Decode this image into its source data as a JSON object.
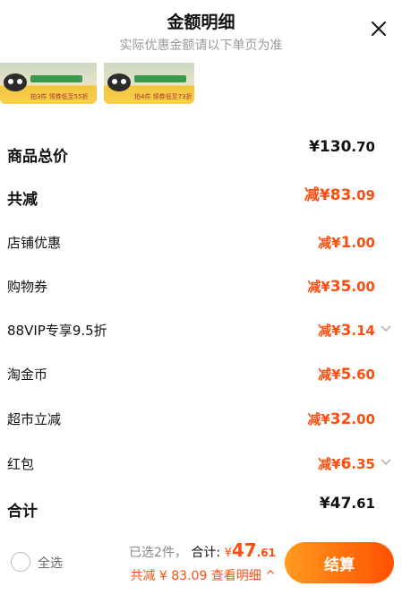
{
  "header": {
    "title": "金额明细",
    "subtitle": "实际优惠金额请以下单页为准"
  },
  "thumbnails": [
    {
      "promo": "拍3件 领券低至55折",
      "badge": "领券满199减30"
    },
    {
      "promo": "拍4件 领券低至73折",
      "badge": "领券满199减30"
    }
  ],
  "rows": [
    {
      "label": "商品总价",
      "prefix": "¥",
      "int": "130",
      "dec": ".70"
    },
    {
      "label": "共减",
      "prefix": "减¥",
      "int": "83",
      "dec": ".09"
    },
    {
      "label": "店铺优惠",
      "prefix": "减¥",
      "int": "1",
      "dec": ".00"
    },
    {
      "label": "购物券",
      "prefix": "减¥",
      "int": "35",
      "dec": ".00"
    },
    {
      "label": "88VIP专享9.5折",
      "prefix": "减¥",
      "int": "3",
      "dec": ".14"
    },
    {
      "label": "淘金币",
      "prefix": "减¥",
      "int": "5",
      "dec": ".60"
    },
    {
      "label": "超市立减",
      "prefix": "减¥",
      "int": "32",
      "dec": ".00"
    },
    {
      "label": "红包",
      "prefix": "减¥",
      "int": "6",
      "dec": ".35"
    },
    {
      "label": "合计",
      "prefix": "¥",
      "int": "47",
      "dec": ".61"
    }
  ],
  "footer": {
    "select_all": "全选",
    "selected": "已选2件，",
    "total_label": "合计:",
    "total_currency": "¥",
    "total_int": "47",
    "total_dec": ".61",
    "discount_text": "共减 ¥ 83.09  查看明细 ^",
    "checkout": "结算"
  },
  "colors": {
    "accent": "#ff4d0f",
    "button_start": "#ff9a1e",
    "button_end": "#ff5000"
  }
}
